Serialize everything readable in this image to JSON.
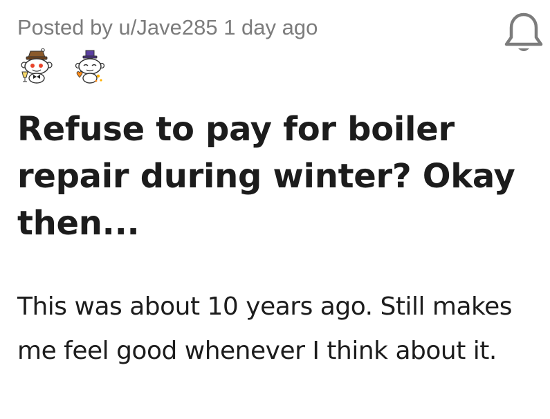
{
  "post": {
    "posted_by_prefix": "Posted by",
    "username": "u/Jave285",
    "time_ago": "1 day ago",
    "title": "Refuse to pay for boiler repair during winter? Okay then...",
    "body": "This was about 10 years ago. Still makes me feel good whenever I think about it."
  },
  "awards": [
    {
      "icon": "snoo-award-icon"
    },
    {
      "icon": "snoo-wholesome-award-icon"
    }
  ],
  "icons": {
    "notification": "bell-icon"
  },
  "colors": {
    "meta_text": "#7c7c7c",
    "title_text": "#1c1c1c",
    "body_text": "#1c1c1c",
    "icon_gray": "#7c7c7c"
  }
}
